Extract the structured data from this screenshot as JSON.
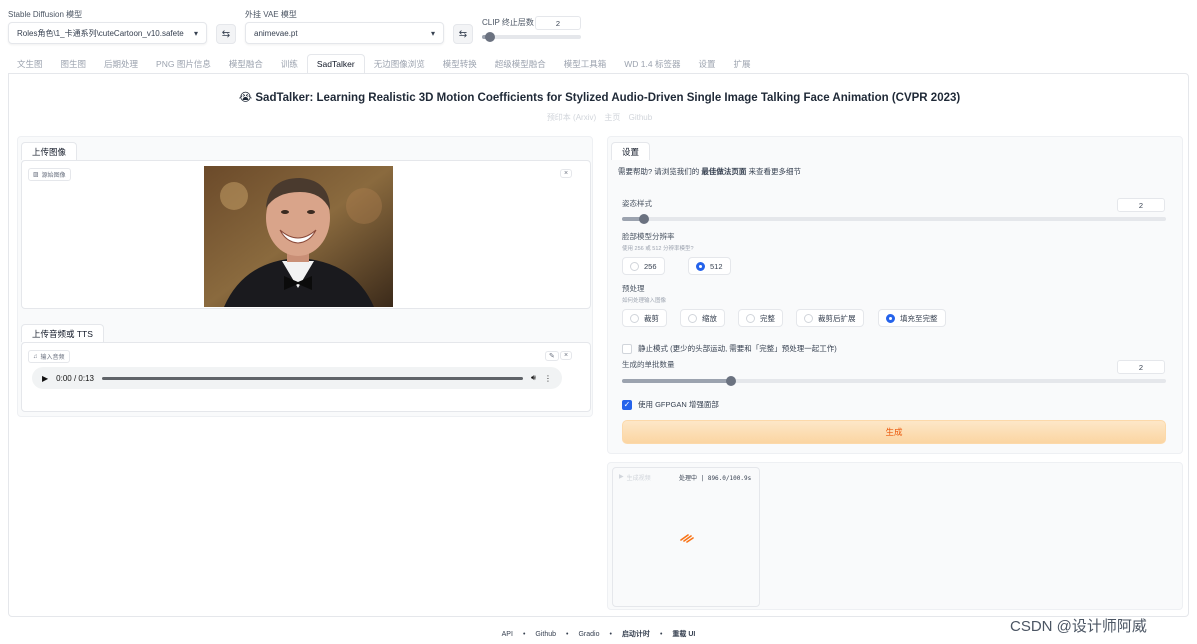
{
  "header": {
    "sd_model_label": "Stable Diffusion 模型",
    "sd_model_value": "Roles角色\\1_卡通系列\\cuteCartoon_v10.safete",
    "vae_label": "外挂 VAE 模型",
    "vae_value": "animevae.pt",
    "clip_label": "CLIP 终止层数",
    "clip_value": "2",
    "clip_level": 0.08
  },
  "tabs": [
    "文生图",
    "图生图",
    "后期处理",
    "PNG 图片信息",
    "模型融合",
    "训练",
    "SadTalker",
    "无边图像浏览",
    "模型转换",
    "超级模型融合",
    "模型工具箱",
    "WD 1.4 标签器",
    "设置",
    "扩展"
  ],
  "title": {
    "emoji": "😭",
    "text": "SadTalker: Learning Realistic 3D Motion Coefficients for Stylized Audio-Driven Single Image Talking Face Animation (CVPR 2023)",
    "links": [
      "预印本 (Arxiv)",
      "主页",
      "Github"
    ]
  },
  "left": {
    "image_tab": "上传图像",
    "image_chip": "源始图像",
    "audio_tab": "上传音频或 TTS",
    "audio_chip": "输入音频",
    "audio_time": "0:00 / 0:13",
    "audio_progress": 0.0
  },
  "settings": {
    "tab": "设置",
    "help_prefix": "需要帮助? 请浏览我们的",
    "help_link": "最佳做法页面",
    "help_suffix": "来查看更多细节",
    "pose_label": "姿态样式",
    "pose_value": "2",
    "pose_level": 0.04,
    "res_label": "脸部模型分辨率",
    "res_hint": "使用 256 或 512 分辨率模型?",
    "res_options": [
      "256",
      "512"
    ],
    "res_selected": "512",
    "pre_label": "预处理",
    "pre_hint": "如何处理输入图像",
    "pre_options": [
      "裁剪",
      "缩放",
      "完整",
      "裁剪后扩展",
      "填充至完整"
    ],
    "pre_selected": "填充至完整",
    "still_label": "静止模式 (更少的头部运动, 需要和「完整」预处理一起工作)",
    "batch_label": "生成的单批数量",
    "batch_value": "2",
    "batch_level": 0.2,
    "gfpgan_label": "使用 GFPGAN 增强面部",
    "generate": "生成"
  },
  "output": {
    "chip": "生成视频",
    "status": "处理中 | 896.0/100.9s"
  },
  "footer": [
    "API",
    "Github",
    "Gradio",
    "启动计时",
    "重载 UI"
  ],
  "watermark": "CSDN @设计师阿威"
}
